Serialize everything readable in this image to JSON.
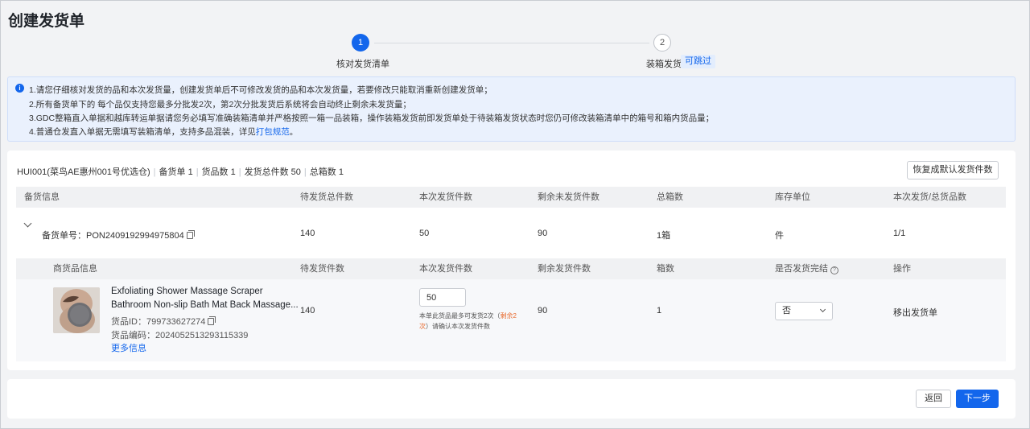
{
  "page": {
    "title": "创建发货单"
  },
  "steps": [
    {
      "number": "1",
      "label": "核对发货清单"
    },
    {
      "number": "2",
      "label": "装箱发货",
      "tag": "可跳过"
    }
  ],
  "notice": {
    "line1": "1.请您仔细核对发货的品和本次发货量，创建发货单后不可修改发货的品和本次发货量，若要修改只能取消重新创建发货单；",
    "line2": "2.所有备货单下的 每个品仅支持您最多分批发2次，第2次分批发货后系统将会自动终止剩余未发货量；",
    "line3": "3.GDC整箱直入单据和越库转运单据请您务必填写准确装箱清单并严格按照一箱一品装箱，操作装箱发货前即发货单处于待装箱发货状态时您仍可修改装箱清单中的箱号和箱内货品量；",
    "line4_prefix": "4.普通仓发直入单据无需填写装箱清单，支持多品混装，详见",
    "line4_link": "打包规范",
    "line4_suffix": "。"
  },
  "summary": {
    "warehouse": "HUI001(菜鸟AE惠州001号优选仓)",
    "orders": "备货单 1",
    "items": "货品数 1",
    "total_qty": "发货总件数 50",
    "boxes": "总箱数 1",
    "separator": "|"
  },
  "reset_button": "恢复成默认发货件数",
  "order_table": {
    "headers": [
      "备货信息",
      "待发货总件数",
      "本次发货件数",
      "剩余未发货件数",
      "总箱数",
      "库存单位",
      "本次发货/总货品数"
    ],
    "row": {
      "order_no": "备货单号：PON2409192994975804",
      "pending": "140",
      "this_qty": "50",
      "remaining": "90",
      "boxes": "1箱",
      "unit": "件",
      "ratio": "1/1"
    }
  },
  "item_table": {
    "headers": [
      "商货品信息",
      "待发货件数",
      "本次发货件数",
      "剩余发货件数",
      "箱数",
      "是否发货完结",
      "操作"
    ],
    "row": {
      "name_line1": "Exfoliating Shower Massage Scraper",
      "name_line2": "Bathroom Non-slip Bath Mat Back Massage...",
      "product_id": "货品ID：799733627274",
      "product_code": "货品编码：2024052513293115339",
      "more": "更多信息",
      "pending": "140",
      "qty_value": "50",
      "hint_prefix": "本单此货品最多可发货2次（",
      "hint_warn1": "剩余2",
      "hint_warn2": "次",
      "hint_suffix": "）请确认本次发货件数",
      "remaining": "90",
      "boxes": "1",
      "finished": "否",
      "action": "移出发货单"
    }
  },
  "footer": {
    "back": "返回",
    "next": "下一步"
  },
  "icons": {
    "info": "info-icon",
    "copy": "copy-icon",
    "help": "question-circle-icon",
    "chevron": "chevron-down-icon"
  },
  "colors": {
    "primary": "#1366ec",
    "warning": "#e8692c",
    "notice_bg": "#eaf1fd"
  }
}
